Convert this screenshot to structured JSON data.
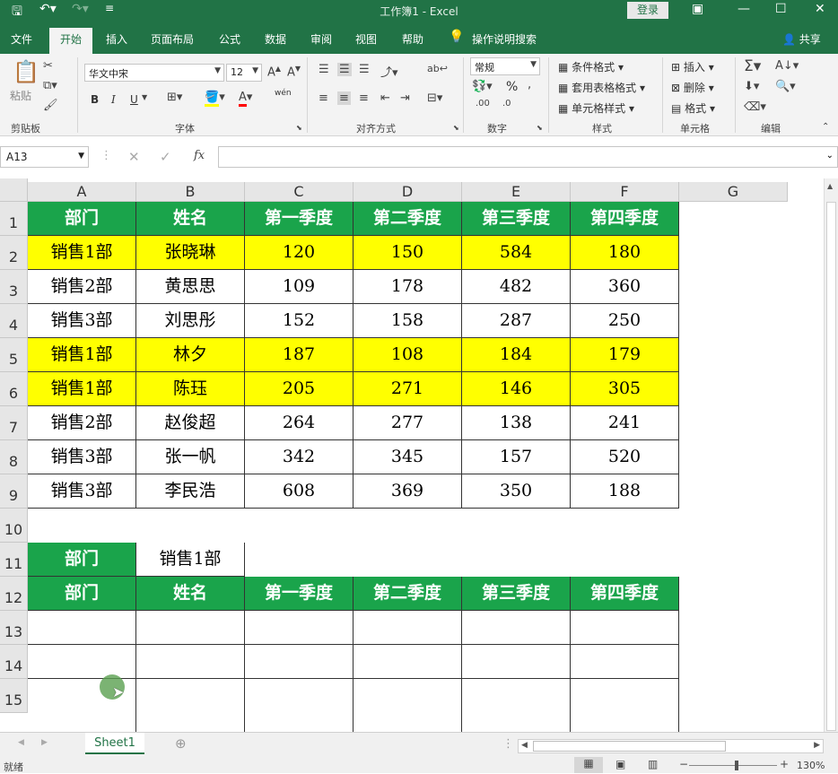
{
  "titlebar": {
    "title": "工作簿1  -  Excel",
    "login": "登录"
  },
  "menu": [
    "文件",
    "开始",
    "插入",
    "页面布局",
    "公式",
    "数据",
    "审阅",
    "视图",
    "帮助"
  ],
  "tell_me": "操作说明搜索",
  "share": "共享",
  "ribbon": {
    "clipboard": {
      "paste": "粘贴",
      "label": "剪贴板"
    },
    "font": {
      "name": "华文中宋",
      "size": "12",
      "label": "字体",
      "bold": "B",
      "italic": "I",
      "underline": "U",
      "phonetic": "wén"
    },
    "align": {
      "label": "对齐方式"
    },
    "number": {
      "format": "常规",
      "label": "数字",
      "percent": "%"
    },
    "styles": {
      "cond": "条件格式",
      "table": "套用表格格式",
      "cell": "单元格样式",
      "label": "样式"
    },
    "cells": {
      "insert": "插入",
      "delete": "删除",
      "format": "格式",
      "label": "单元格"
    },
    "edit": {
      "label": "编辑"
    }
  },
  "namebox": "A13",
  "fx": "fx",
  "columns": [
    "A",
    "B",
    "C",
    "D",
    "E",
    "F",
    "G"
  ],
  "rows": [
    "1",
    "2",
    "3",
    "4",
    "5",
    "6",
    "7",
    "8",
    "9",
    "10",
    "11",
    "12",
    "13",
    "14",
    "15"
  ],
  "table": {
    "headers": [
      "部门",
      "姓名",
      "第一季度",
      "第二季度",
      "第三季度",
      "第四季度"
    ],
    "data": [
      [
        "销售1部",
        "张晓琳",
        "120",
        "150",
        "584",
        "180"
      ],
      [
        "销售2部",
        "黄思思",
        "109",
        "178",
        "482",
        "360"
      ],
      [
        "销售3部",
        "刘思彤",
        "152",
        "158",
        "287",
        "250"
      ],
      [
        "销售1部",
        "林夕",
        "187",
        "108",
        "184",
        "179"
      ],
      [
        "销售1部",
        "陈珏",
        "205",
        "271",
        "146",
        "305"
      ],
      [
        "销售2部",
        "赵俊超",
        "264",
        "277",
        "138",
        "241"
      ],
      [
        "销售3部",
        "张一帆",
        "342",
        "345",
        "157",
        "520"
      ],
      [
        "销售3部",
        "李民浩",
        "608",
        "369",
        "350",
        "188"
      ]
    ]
  },
  "criteria": {
    "label": "部门",
    "value": "销售1部"
  },
  "result_headers": [
    "部门",
    "姓名",
    "第一季度",
    "第二季度",
    "第三季度",
    "第四季度"
  ],
  "sheet_tab": "Sheet1",
  "status": {
    "ready": "就绪",
    "zoom": "130%"
  },
  "colors": {
    "accent": "#217346",
    "header_green": "#1aa44b",
    "highlight": "#ffff00"
  }
}
